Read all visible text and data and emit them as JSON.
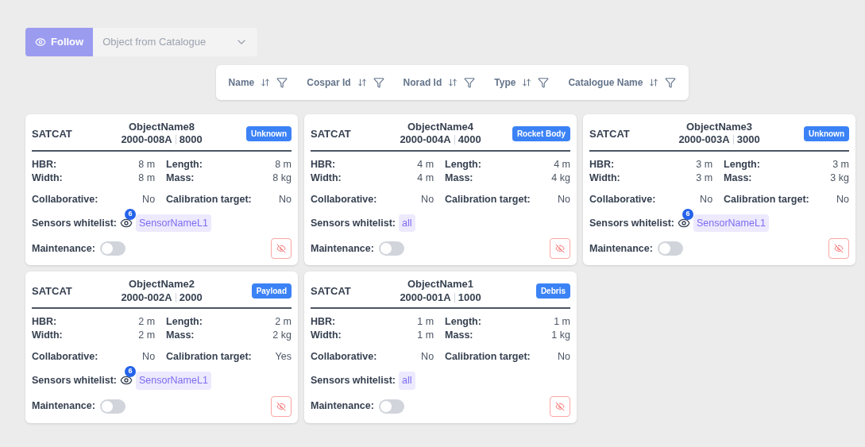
{
  "toolbar": {
    "follow_button": "Follow",
    "select": {
      "placeholder": "Object from Catalogue"
    }
  },
  "columns": [
    "Name",
    "Cospar Id",
    "Norad Id",
    "Type",
    "Catalogue Name"
  ],
  "cards": [
    {
      "catalogue": "SATCAT",
      "name": "ObjectName8",
      "cospar": "2000-008A",
      "norad": "8000",
      "type": "Unknown",
      "fields": [
        {
          "label": "HBR:",
          "value": "8 m"
        },
        {
          "label": "Length:",
          "value": "8 m"
        },
        {
          "label": "Width:",
          "value": "8 m"
        },
        {
          "label": "Mass:",
          "value": "8 kg"
        },
        {
          "label": "Collaborative:",
          "value": "No"
        },
        {
          "label": "Calibration target:",
          "value": "No"
        }
      ],
      "sensors": {
        "label": "Sensors whitelist:",
        "count": "6",
        "chips": [
          "SensorNameL1"
        ]
      },
      "maintenance": {
        "label": "Maintenance:",
        "on": false
      }
    },
    {
      "catalogue": "SATCAT",
      "name": "ObjectName4",
      "cospar": "2000-004A",
      "norad": "4000",
      "type": "Rocket Body",
      "fields": [
        {
          "label": "HBR:",
          "value": "4 m"
        },
        {
          "label": "Length:",
          "value": "4 m"
        },
        {
          "label": "Width:",
          "value": "4 m"
        },
        {
          "label": "Mass:",
          "value": "4 kg"
        },
        {
          "label": "Collaborative:",
          "value": "No"
        },
        {
          "label": "Calibration target:",
          "value": "No"
        }
      ],
      "sensors": {
        "label": "Sensors whitelist:",
        "chips": [
          "all"
        ]
      },
      "maintenance": {
        "label": "Maintenance:",
        "on": false
      }
    },
    {
      "catalogue": "SATCAT",
      "name": "ObjectName3",
      "cospar": "2000-003A",
      "norad": "3000",
      "type": "Unknown",
      "fields": [
        {
          "label": "HBR:",
          "value": "3 m"
        },
        {
          "label": "Length:",
          "value": "3 m"
        },
        {
          "label": "Width:",
          "value": "3 m"
        },
        {
          "label": "Mass:",
          "value": "3 kg"
        },
        {
          "label": "Collaborative:",
          "value": "No"
        },
        {
          "label": "Calibration target:",
          "value": "No"
        }
      ],
      "sensors": {
        "label": "Sensors whitelist:",
        "count": "6",
        "chips": [
          "SensorNameL1"
        ]
      },
      "maintenance": {
        "label": "Maintenance:",
        "on": false
      }
    },
    {
      "catalogue": "SATCAT",
      "name": "ObjectName2",
      "cospar": "2000-002A",
      "norad": "2000",
      "type": "Payload",
      "fields": [
        {
          "label": "HBR:",
          "value": "2 m"
        },
        {
          "label": "Length:",
          "value": "2 m"
        },
        {
          "label": "Width:",
          "value": "2 m"
        },
        {
          "label": "Mass:",
          "value": "2 kg"
        },
        {
          "label": "Collaborative:",
          "value": "No"
        },
        {
          "label": "Calibration target:",
          "value": "Yes"
        }
      ],
      "sensors": {
        "label": "Sensors whitelist:",
        "count": "6",
        "chips": [
          "SensorNameL1"
        ]
      },
      "maintenance": {
        "label": "Maintenance:",
        "on": false
      }
    },
    {
      "catalogue": "SATCAT",
      "name": "ObjectName1",
      "cospar": "2000-001A",
      "norad": "1000",
      "type": "Debris",
      "fields": [
        {
          "label": "HBR:",
          "value": "1 m"
        },
        {
          "label": "Length:",
          "value": "1 m"
        },
        {
          "label": "Width:",
          "value": "1 m"
        },
        {
          "label": "Mass:",
          "value": "1 kg"
        },
        {
          "label": "Collaborative:",
          "value": "No"
        },
        {
          "label": "Calibration target:",
          "value": "No"
        }
      ],
      "sensors": {
        "label": "Sensors whitelist:",
        "chips": [
          "all"
        ]
      },
      "maintenance": {
        "label": "Maintenance:",
        "on": false
      }
    }
  ]
}
